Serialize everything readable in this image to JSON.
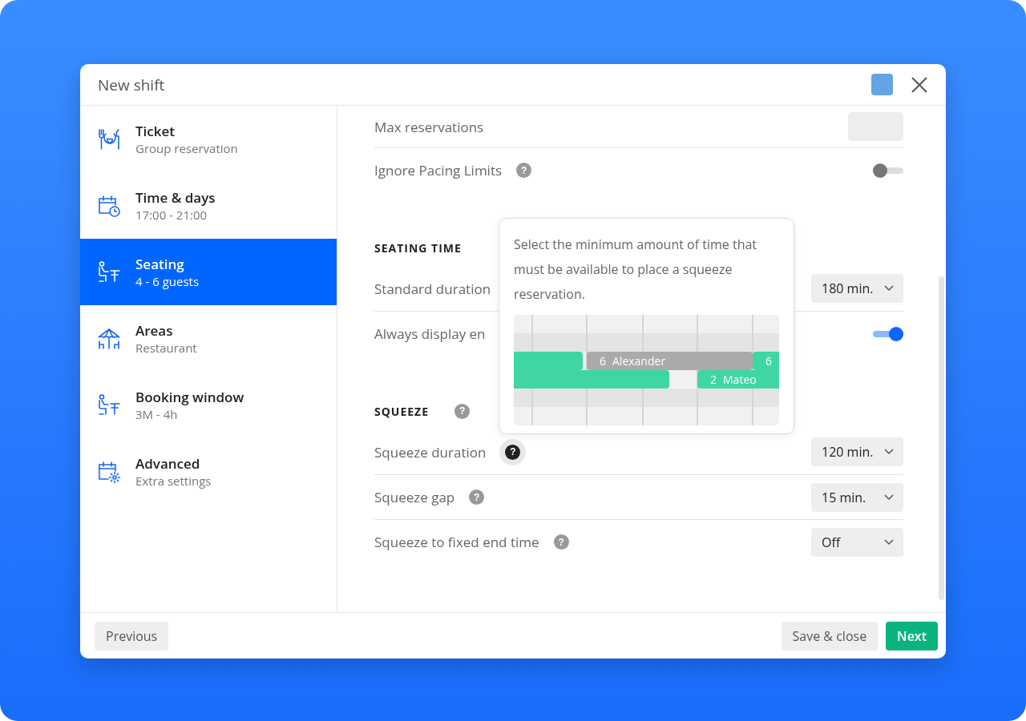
{
  "window": {
    "title": "New shift"
  },
  "sidebar": {
    "items": [
      {
        "title": "Ticket",
        "subtitle": "Group reservation",
        "selected": false
      },
      {
        "title": "Time & days",
        "subtitle": "17:00 - 21:00",
        "selected": false
      },
      {
        "title": "Seating",
        "subtitle": "4 - 6 guests",
        "selected": true
      },
      {
        "title": "Areas",
        "subtitle": "Restaurant",
        "selected": false
      },
      {
        "title": "Booking window",
        "subtitle": "3M - 4h",
        "selected": false
      },
      {
        "title": "Advanced",
        "subtitle": "Extra settings",
        "selected": false
      }
    ]
  },
  "sections": [
    {
      "rows": [
        {
          "kind": "input",
          "label": "Max reservations"
        },
        {
          "kind": "toggle",
          "label": "Ignore Pacing Limits",
          "help": "?",
          "help_highlighted": false,
          "on": false
        }
      ]
    },
    {
      "title": "SEATING TIME",
      "rows": [
        {
          "kind": "select",
          "label": "Standard duration",
          "value": "180 min."
        },
        {
          "kind": "toggle",
          "label": "Always display en",
          "on": true
        }
      ]
    },
    {
      "title": "SQUEEZE",
      "help": "?",
      "rows": [
        {
          "kind": "select",
          "label": "Squeeze duration",
          "help": "?",
          "help_highlighted": true,
          "value": "120 min."
        },
        {
          "kind": "select",
          "label": "Squeeze gap",
          "help": "?",
          "help_highlighted": false,
          "value": "15 min."
        },
        {
          "kind": "select",
          "label": "Squeeze to fixed end time",
          "help": "?",
          "help_highlighted": false,
          "value": "Off"
        }
      ]
    }
  ],
  "tooltip": {
    "text": "Select the minimum amount of time that must be available to place a squeeze reservation.",
    "bars": [
      {
        "kind": "booked"
      },
      {
        "kind": "squeeze",
        "guests": "6",
        "name": "Alexander"
      },
      {
        "kind": "booked",
        "guests": "6"
      },
      {
        "kind": "booked"
      },
      {
        "kind": "booked",
        "guests": "2",
        "name": "Mateo"
      }
    ]
  },
  "footer": {
    "buttons": [
      {
        "label": "Previous",
        "kind": "secondary"
      },
      {
        "label": "Save & close",
        "kind": "secondary"
      },
      {
        "label": "Next",
        "kind": "primary"
      }
    ]
  }
}
